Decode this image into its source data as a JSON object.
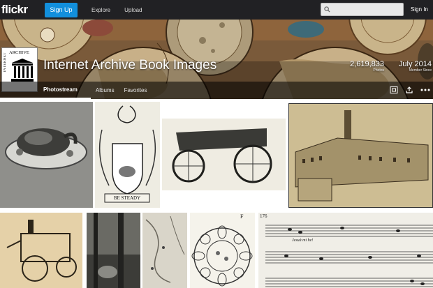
{
  "topbar": {
    "logo": "flickr",
    "signup_label": "Sign Up",
    "nav": [
      "Explore",
      "Upload"
    ],
    "signin_label": "Sign In",
    "search_icon": "search-icon"
  },
  "profile": {
    "avatar_text_vertical": "INTERNET",
    "avatar_text_horizontal": "ARCHIVE",
    "title": "Internet Archive Book Images",
    "photos_count": "2,619,833",
    "photos_label": "Photos",
    "member_since": "July 2014",
    "member_since_label": "Member Since"
  },
  "tabs": [
    "Photostream",
    "Albums",
    "Favorites"
  ],
  "tab_icons": [
    "slideshow-icon",
    "share-icon",
    "more-icon"
  ],
  "photos": [
    {
      "name": "photo-roast-bird"
    },
    {
      "name": "photo-coat-of-arms",
      "motto": "BE STEADY"
    },
    {
      "name": "photo-wagon"
    },
    {
      "name": "photo-factory"
    },
    {
      "name": "photo-engine-machine"
    },
    {
      "name": "photo-forest-scene"
    },
    {
      "name": "photo-map"
    },
    {
      "name": "photo-circular-diagram",
      "label": "F"
    },
    {
      "name": "photo-sheet-music",
      "page": "176",
      "lyric": "Jesuà mi he!"
    }
  ],
  "colors": {
    "topbar": "#212124",
    "signup": "#128fdc"
  }
}
